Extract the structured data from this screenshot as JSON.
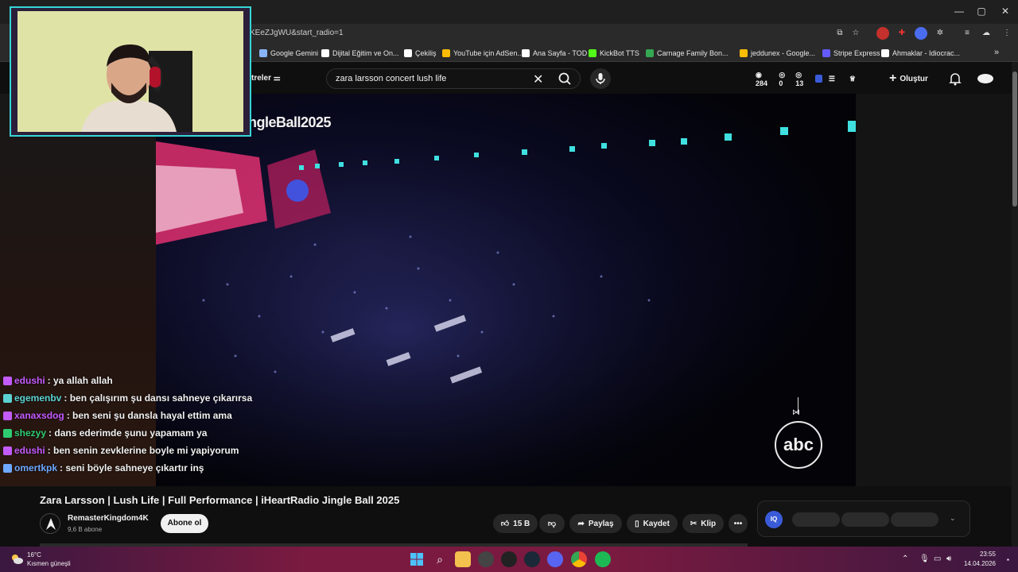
{
  "browser": {
    "url_fragment": "KEeZJgWU&start_radio=1",
    "bookmarks": [
      {
        "label": "Google Gemini",
        "color": "#8ab4f8"
      },
      {
        "label": "Dijital Eğitim ve On...",
        "color": "#ffffff"
      },
      {
        "label": "Çekiliş",
        "color": "#ffffff"
      },
      {
        "label": "YouTube için AdSen...",
        "color": "#fbbc04"
      },
      {
        "label": "Ana Sayfa - TOD",
        "color": "#ffffff"
      },
      {
        "label": "KickBot TTS",
        "color": "#53fc18"
      },
      {
        "label": "Carnage Family Bon...",
        "color": "#34a853"
      },
      {
        "label": "jeddunex - Google...",
        "color": "#fbbc04"
      },
      {
        "label": "Stripe Express",
        "color": "#635bff"
      },
      {
        "label": "Ahmaklar - Idiocrac...",
        "color": "#ffffff"
      }
    ]
  },
  "youtube": {
    "filters_label": "treler",
    "search": {
      "value": "zara larsson concert lush life"
    },
    "stats": {
      "a": "284",
      "b": "0",
      "c": "13"
    },
    "create_label": "Oluştur"
  },
  "video": {
    "overlay_title": "ngleBall2025",
    "logo_text": "abc",
    "title": "Zara Larsson | Lush Life | Full Performance | iHeartRadio Jingle Ball 2025",
    "channel": {
      "name": "RemasterKingdom4K",
      "subs": "9,6 B abone"
    },
    "subscribe_label": "Abone ol",
    "likes": "15 B",
    "share_label": "Paylaş",
    "save_label": "Kaydet",
    "clip_label": "Klip",
    "ext_label": "IQ"
  },
  "chat": [
    {
      "user": "edushi",
      "text": ": ya allah allah",
      "color": "#c45bff"
    },
    {
      "user": "egemenbv",
      "text": ": ben çalışırım şu dansı sahneye çıkarırsa",
      "color": "#5bd2d2"
    },
    {
      "user": "xanaxsdog",
      "text": ": ben seni şu dansla hayal ettim ama",
      "color": "#c45bff"
    },
    {
      "user": "shezyy",
      "text": ": dans ederimde şunu yapamam ya",
      "color": "#2ecc71"
    },
    {
      "user": "edushi",
      "text": ": ben senin zevklerine boyle mi yapiyorum",
      "color": "#c45bff"
    },
    {
      "user": "omertkpk",
      "text": ": seni böyle sahneye çıkartır inş",
      "color": "#6ea8ff"
    }
  ],
  "taskbar": {
    "temp": "16°C",
    "weather": "Kısmen güneşli",
    "time": "23:55",
    "date": "14.04.2026"
  }
}
